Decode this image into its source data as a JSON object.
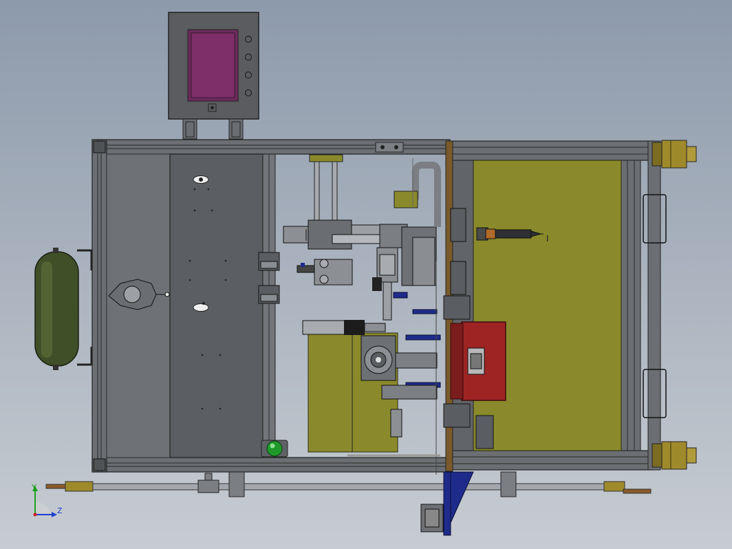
{
  "view": {
    "annotation_label": "I",
    "axis_y_label": "Y",
    "axis_z_label": "Z"
  },
  "colors": {
    "frame": "#55585c",
    "frame_light": "#7b7f84",
    "panel": "#4f5256",
    "olive_panel": "#8a8a2c",
    "control_box": "#5a5c5f",
    "screen": "#7e2f6a",
    "tank": "#3f4f27",
    "red_box": "#9e2424",
    "brass": "#9e8a2b",
    "blue": "#1f2b8a",
    "green_button": "#1f9a2a"
  },
  "icons": {
    "axis_triad": "triad-icon"
  }
}
